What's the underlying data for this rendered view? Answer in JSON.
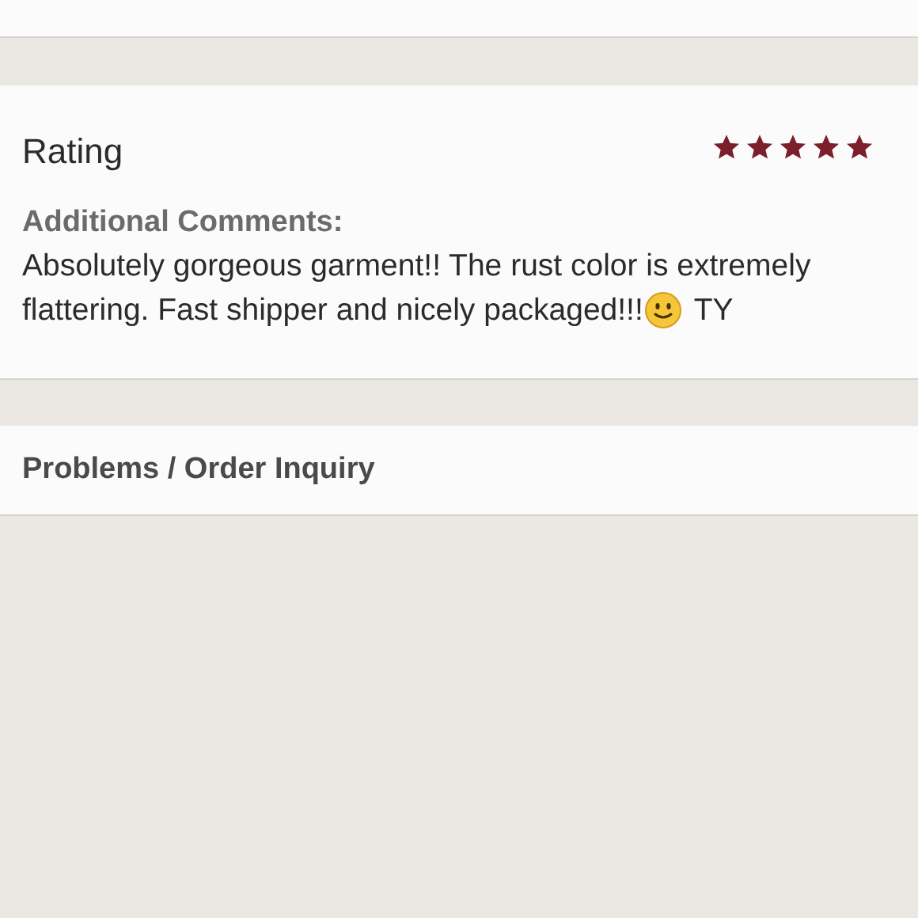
{
  "rating": {
    "label": "Rating",
    "stars": 5
  },
  "comments": {
    "heading": "Additional Comments:",
    "lines": [
      "Absolutely gorgeous garment!! The rust color is extremely",
      "flattering. Fast shipper and nicely packaged!!!"
    ],
    "text_after_emoji": "TY"
  },
  "problems": {
    "label": "Problems / Order Inquiry"
  }
}
